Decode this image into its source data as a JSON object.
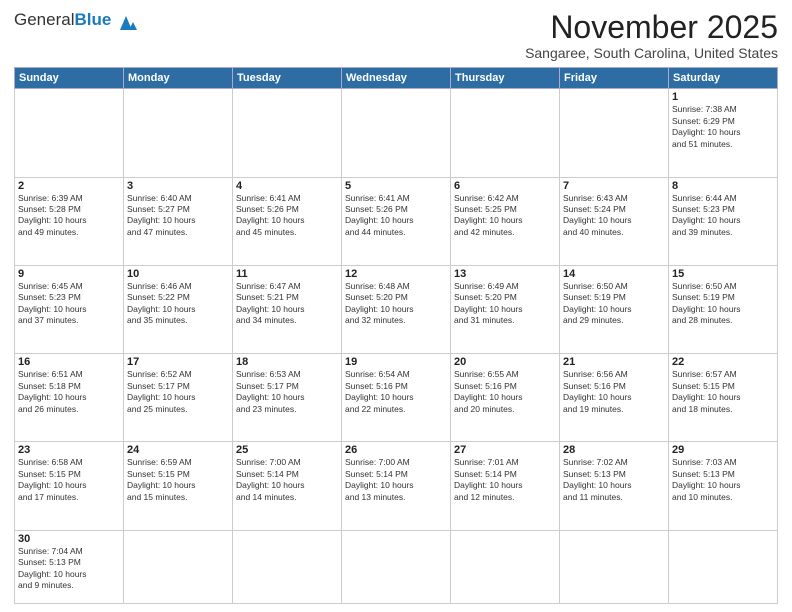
{
  "header": {
    "logo_general": "General",
    "logo_blue": "Blue",
    "title": "November 2025",
    "location": "Sangaree, South Carolina, United States"
  },
  "days_of_week": [
    "Sunday",
    "Monday",
    "Tuesday",
    "Wednesday",
    "Thursday",
    "Friday",
    "Saturday"
  ],
  "weeks": [
    [
      {
        "day": "",
        "text": ""
      },
      {
        "day": "",
        "text": ""
      },
      {
        "day": "",
        "text": ""
      },
      {
        "day": "",
        "text": ""
      },
      {
        "day": "",
        "text": ""
      },
      {
        "day": "",
        "text": ""
      },
      {
        "day": "1",
        "text": "Sunrise: 7:38 AM\nSunset: 6:29 PM\nDaylight: 10 hours\nand 51 minutes."
      }
    ],
    [
      {
        "day": "2",
        "text": "Sunrise: 6:39 AM\nSunset: 5:28 PM\nDaylight: 10 hours\nand 49 minutes."
      },
      {
        "day": "3",
        "text": "Sunrise: 6:40 AM\nSunset: 5:27 PM\nDaylight: 10 hours\nand 47 minutes."
      },
      {
        "day": "4",
        "text": "Sunrise: 6:41 AM\nSunset: 5:26 PM\nDaylight: 10 hours\nand 45 minutes."
      },
      {
        "day": "5",
        "text": "Sunrise: 6:41 AM\nSunset: 5:26 PM\nDaylight: 10 hours\nand 44 minutes."
      },
      {
        "day": "6",
        "text": "Sunrise: 6:42 AM\nSunset: 5:25 PM\nDaylight: 10 hours\nand 42 minutes."
      },
      {
        "day": "7",
        "text": "Sunrise: 6:43 AM\nSunset: 5:24 PM\nDaylight: 10 hours\nand 40 minutes."
      },
      {
        "day": "8",
        "text": "Sunrise: 6:44 AM\nSunset: 5:23 PM\nDaylight: 10 hours\nand 39 minutes."
      }
    ],
    [
      {
        "day": "9",
        "text": "Sunrise: 6:45 AM\nSunset: 5:23 PM\nDaylight: 10 hours\nand 37 minutes."
      },
      {
        "day": "10",
        "text": "Sunrise: 6:46 AM\nSunset: 5:22 PM\nDaylight: 10 hours\nand 35 minutes."
      },
      {
        "day": "11",
        "text": "Sunrise: 6:47 AM\nSunset: 5:21 PM\nDaylight: 10 hours\nand 34 minutes."
      },
      {
        "day": "12",
        "text": "Sunrise: 6:48 AM\nSunset: 5:20 PM\nDaylight: 10 hours\nand 32 minutes."
      },
      {
        "day": "13",
        "text": "Sunrise: 6:49 AM\nSunset: 5:20 PM\nDaylight: 10 hours\nand 31 minutes."
      },
      {
        "day": "14",
        "text": "Sunrise: 6:50 AM\nSunset: 5:19 PM\nDaylight: 10 hours\nand 29 minutes."
      },
      {
        "day": "15",
        "text": "Sunrise: 6:50 AM\nSunset: 5:19 PM\nDaylight: 10 hours\nand 28 minutes."
      }
    ],
    [
      {
        "day": "16",
        "text": "Sunrise: 6:51 AM\nSunset: 5:18 PM\nDaylight: 10 hours\nand 26 minutes."
      },
      {
        "day": "17",
        "text": "Sunrise: 6:52 AM\nSunset: 5:17 PM\nDaylight: 10 hours\nand 25 minutes."
      },
      {
        "day": "18",
        "text": "Sunrise: 6:53 AM\nSunset: 5:17 PM\nDaylight: 10 hours\nand 23 minutes."
      },
      {
        "day": "19",
        "text": "Sunrise: 6:54 AM\nSunset: 5:16 PM\nDaylight: 10 hours\nand 22 minutes."
      },
      {
        "day": "20",
        "text": "Sunrise: 6:55 AM\nSunset: 5:16 PM\nDaylight: 10 hours\nand 20 minutes."
      },
      {
        "day": "21",
        "text": "Sunrise: 6:56 AM\nSunset: 5:16 PM\nDaylight: 10 hours\nand 19 minutes."
      },
      {
        "day": "22",
        "text": "Sunrise: 6:57 AM\nSunset: 5:15 PM\nDaylight: 10 hours\nand 18 minutes."
      }
    ],
    [
      {
        "day": "23",
        "text": "Sunrise: 6:58 AM\nSunset: 5:15 PM\nDaylight: 10 hours\nand 17 minutes."
      },
      {
        "day": "24",
        "text": "Sunrise: 6:59 AM\nSunset: 5:15 PM\nDaylight: 10 hours\nand 15 minutes."
      },
      {
        "day": "25",
        "text": "Sunrise: 7:00 AM\nSunset: 5:14 PM\nDaylight: 10 hours\nand 14 minutes."
      },
      {
        "day": "26",
        "text": "Sunrise: 7:00 AM\nSunset: 5:14 PM\nDaylight: 10 hours\nand 13 minutes."
      },
      {
        "day": "27",
        "text": "Sunrise: 7:01 AM\nSunset: 5:14 PM\nDaylight: 10 hours\nand 12 minutes."
      },
      {
        "day": "28",
        "text": "Sunrise: 7:02 AM\nSunset: 5:13 PM\nDaylight: 10 hours\nand 11 minutes."
      },
      {
        "day": "29",
        "text": "Sunrise: 7:03 AM\nSunset: 5:13 PM\nDaylight: 10 hours\nand 10 minutes."
      }
    ],
    [
      {
        "day": "30",
        "text": "Sunrise: 7:04 AM\nSunset: 5:13 PM\nDaylight: 10 hours\nand 9 minutes."
      },
      {
        "day": "",
        "text": ""
      },
      {
        "day": "",
        "text": ""
      },
      {
        "day": "",
        "text": ""
      },
      {
        "day": "",
        "text": ""
      },
      {
        "day": "",
        "text": ""
      },
      {
        "day": "",
        "text": ""
      }
    ]
  ]
}
